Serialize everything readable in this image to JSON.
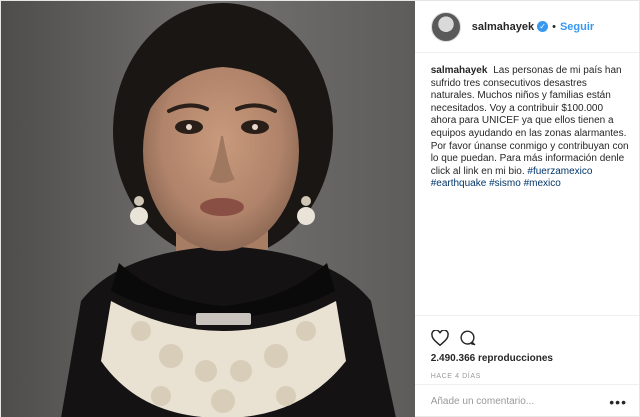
{
  "header": {
    "username": "salmahayek",
    "verified_icon": "verified-badge-icon",
    "separator": "•",
    "follow_label": "Seguir"
  },
  "caption": {
    "username": "salmahayek",
    "text": "Las personas de mi país han sufrido tres consecutivos desastres naturales. Muchos niños y familias están necesitados. Voy a contribuir $100.000 ahora para UNICEF ya que ellos tienen a equipos ayudando en las zonas alarmantes. Por favor únanse conmigo y contribuyan con lo que puedan. Para más información denle click al link en mi bio.",
    "hashtags": [
      "#fuerzamexico",
      "#earthquake",
      "#sismo",
      "#mexico"
    ]
  },
  "actions": {
    "like_icon": "heart-icon",
    "comment_icon": "comment-bubble-icon"
  },
  "stats": {
    "views": "2.490.366 reproducciones",
    "time": "HACE 4 DÍAS"
  },
  "comment": {
    "placeholder": "Añade un comentario...",
    "more_label": "•••"
  },
  "colors": {
    "link_blue": "#3897f0",
    "hashtag": "#003569",
    "border": "#efefef",
    "muted": "#999999"
  }
}
